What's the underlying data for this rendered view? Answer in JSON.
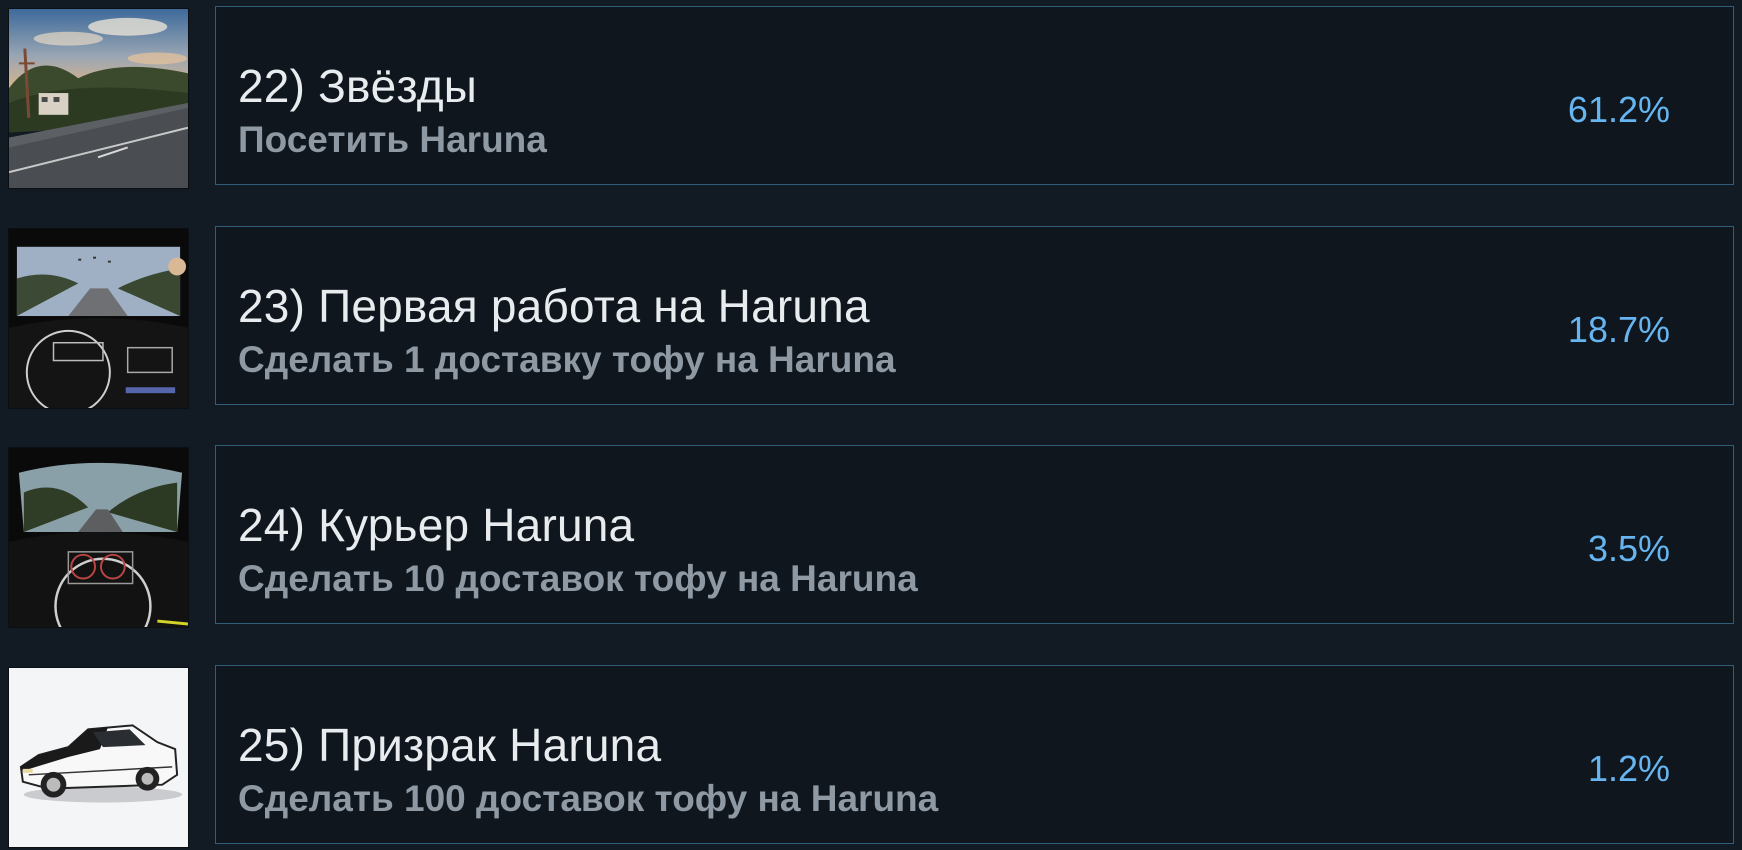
{
  "achievements": [
    {
      "title": "22) Звёзды",
      "description": "Посетить Haruna",
      "percent": "61.2%",
      "image": "evening-road-scene"
    },
    {
      "title": "23) Первая работа на Haruna",
      "description": "Сделать 1 доставку тофу на Haruna",
      "percent": "18.7%",
      "image": "cockpit-view-road"
    },
    {
      "title": "24) Курьер Haruna",
      "description": "Сделать 10 доставок тофу на Haruna",
      "percent": "3.5%",
      "image": "cockpit-view-forest"
    },
    {
      "title": "25) Призрак Haruna",
      "description": "Сделать 100 доставок тофу на Haruna",
      "percent": "1.2%",
      "image": "white-hatchback-car"
    }
  ],
  "colors": {
    "background": "#121a23",
    "card_border": "#2f5e78",
    "title": "#e8ecef",
    "description": "#8e99a3",
    "percent": "#66b5f0"
  }
}
